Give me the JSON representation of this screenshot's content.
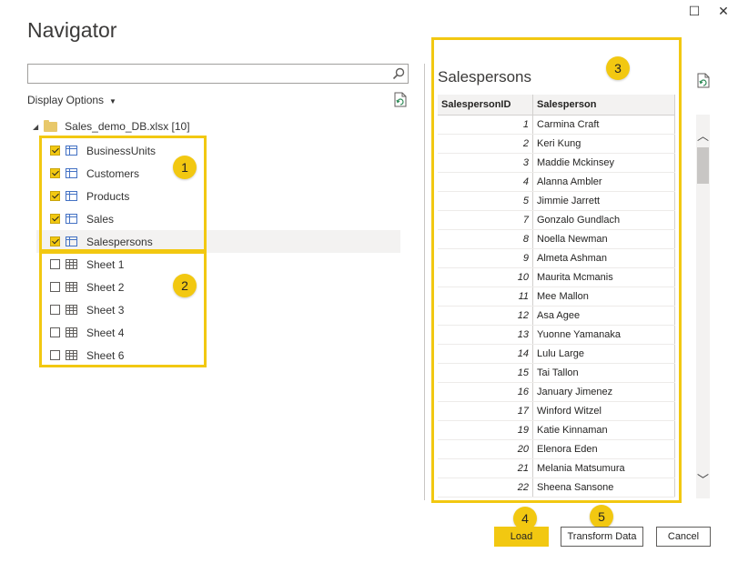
{
  "window": {
    "title": "Navigator",
    "maximize_glyph": "☐",
    "close_glyph": "✕"
  },
  "search": {
    "value": "",
    "placeholder": ""
  },
  "display_options": {
    "label": "Display Options",
    "caret": "▼"
  },
  "tree": {
    "root": "Sales_demo_DB.xlsx [10]",
    "tables": [
      {
        "label": "BusinessUnits",
        "checked": true
      },
      {
        "label": "Customers",
        "checked": true
      },
      {
        "label": "Products",
        "checked": true
      },
      {
        "label": "Sales",
        "checked": true
      },
      {
        "label": "Salespersons",
        "checked": true
      }
    ],
    "sheets": [
      {
        "label": "Sheet 1",
        "checked": false
      },
      {
        "label": "Sheet 2",
        "checked": false
      },
      {
        "label": "Sheet 3",
        "checked": false
      },
      {
        "label": "Sheet 4",
        "checked": false
      },
      {
        "label": "Sheet 6",
        "checked": false
      }
    ]
  },
  "badges": [
    "1",
    "2",
    "3",
    "4",
    "5"
  ],
  "preview": {
    "title": "Salespersons",
    "columns": [
      "SalespersonID",
      "Salesperson"
    ],
    "rows": [
      [
        "1",
        "Carmina Craft"
      ],
      [
        "2",
        "Keri Kung"
      ],
      [
        "3",
        "Maddie Mckinsey"
      ],
      [
        "4",
        "Alanna Ambler"
      ],
      [
        "5",
        "Jimmie Jarrett"
      ],
      [
        "7",
        "Gonzalo Gundlach"
      ],
      [
        "8",
        "Noella Newman"
      ],
      [
        "9",
        "Almeta Ashman"
      ],
      [
        "10",
        "Maurita Mcmanis"
      ],
      [
        "11",
        "Mee Mallon"
      ],
      [
        "12",
        "Asa Agee"
      ],
      [
        "13",
        "Yuonne Yamanaka"
      ],
      [
        "14",
        "Lulu Large"
      ],
      [
        "15",
        "Tai Tallon"
      ],
      [
        "16",
        "January Jimenez"
      ],
      [
        "17",
        "Winford Witzel"
      ],
      [
        "19",
        "Katie Kinnaman"
      ],
      [
        "20",
        "Elenora Eden"
      ],
      [
        "21",
        "Melania Matsumura"
      ],
      [
        "22",
        "Sheena Sansone"
      ]
    ]
  },
  "scroll": {
    "up_glyph": "︿",
    "down_glyph": "﹀"
  },
  "buttons": {
    "load": "Load",
    "transform": "Transform Data",
    "cancel": "Cancel"
  },
  "colors": {
    "accent": "#f2c811",
    "table_icon": "#4472c4"
  }
}
